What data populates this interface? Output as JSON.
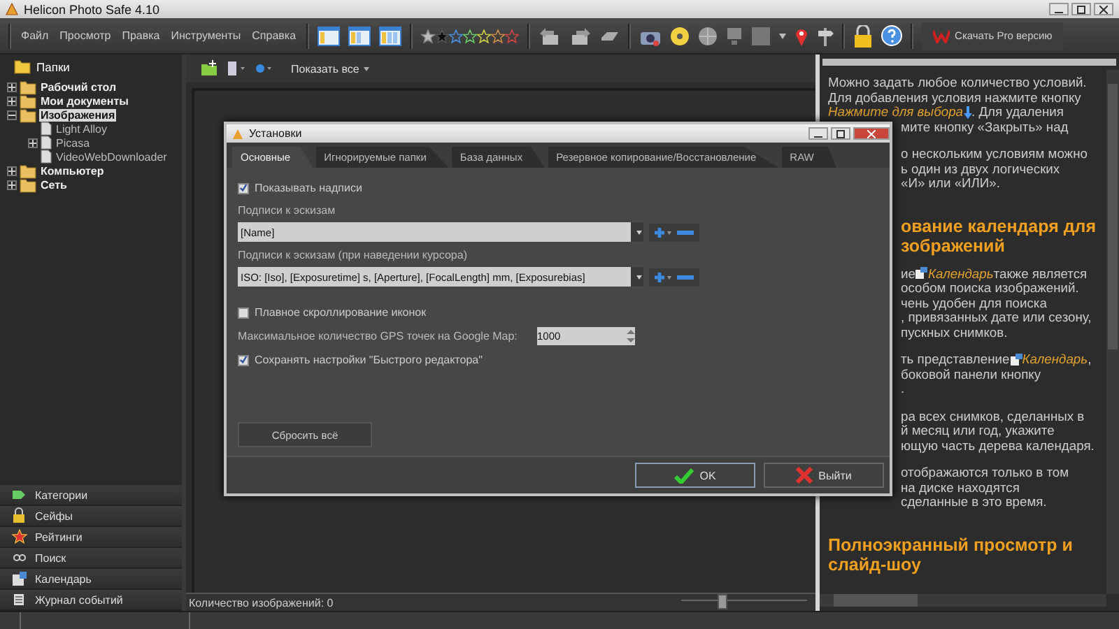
{
  "window": {
    "title": "Helicon Photo Safe 4.10"
  },
  "menu": [
    "Файл",
    "Просмотр",
    "Правка",
    "Инструменты",
    "Справка"
  ],
  "pro_button": "Скачать Pro версию",
  "folders": {
    "title": "Папки",
    "tree": [
      {
        "label": "Рабочий стол",
        "expanded": false,
        "selected": false
      },
      {
        "label": "Мои документы",
        "expanded": false,
        "selected": false
      },
      {
        "label": "Изображения",
        "expanded": true,
        "selected": true,
        "children": [
          {
            "label": "Light Alloy",
            "selected": false
          },
          {
            "label": "Picasa",
            "expanded": false,
            "selected": false
          },
          {
            "label": "VideoWebDownloader",
            "selected": false
          }
        ]
      },
      {
        "label": "Компьютер",
        "expanded": false,
        "selected": false
      },
      {
        "label": "Сеть",
        "expanded": false,
        "selected": false
      }
    ]
  },
  "side_panels": [
    {
      "label": "Категории",
      "kind": "tags"
    },
    {
      "label": "Сейфы",
      "kind": "lock"
    },
    {
      "label": "Рейтинги",
      "kind": "rating"
    },
    {
      "label": "Поиск",
      "kind": "search"
    },
    {
      "label": "Календарь",
      "kind": "calendar"
    },
    {
      "label": "Журнал событий",
      "kind": "log"
    }
  ],
  "view_toolbar": {
    "filter": "Показать все"
  },
  "status_bar": {
    "count": "Количество изображений: 0",
    "zoom_slider": {
      "level": 0.3
    }
  },
  "help": {
    "blocks": [
      {
        "kind": "text",
        "lines": [
          {
            "covered": false,
            "segments": [
              {
                "kind": "text",
                "text": "Можно задать любое количество условий."
              }
            ]
          },
          {
            "covered": false,
            "segments": [
              {
                "kind": "text",
                "text": "Для добавления условия нажмите кнопку"
              }
            ]
          },
          {
            "covered": false,
            "segments": [
              {
                "kind": "link",
                "text": "Нажмите для выбора"
              },
              {
                "kind": "arrow"
              },
              {
                "kind": "text",
                "text": " . Для удаления"
              }
            ]
          },
          {
            "covered": true,
            "segments": [
              {
                "kind": "text",
                "text": "мите кнопку «Закрыть» над"
              }
            ]
          }
        ]
      },
      {
        "kind": "text",
        "lines": [
          {
            "covered": true,
            "segments": [
              {
                "kind": "text",
                "text": "о нескольким условиям можно"
              }
            ]
          },
          {
            "covered": true,
            "segments": [
              {
                "kind": "text",
                "text": "ь один из двух логических"
              }
            ]
          },
          {
            "covered": true,
            "segments": [
              {
                "kind": "text",
                "text": "«И» или «ИЛИ»."
              }
            ]
          }
        ]
      },
      {
        "kind": "heading",
        "lines": [
          {
            "covered": true,
            "segments": [
              {
                "kind": "text",
                "text": "ование календаря для"
              }
            ]
          },
          {
            "covered": true,
            "segments": [
              {
                "kind": "text",
                "text": "зображений"
              }
            ]
          }
        ]
      },
      {
        "kind": "text",
        "lines": [
          {
            "covered": true,
            "segments": [
              {
                "kind": "text",
                "text": "ие "
              },
              {
                "kind": "calendar"
              },
              {
                "kind": "link",
                "text": "Календарь"
              },
              {
                "kind": "text",
                "text": " также является"
              }
            ]
          },
          {
            "covered": true,
            "segments": [
              {
                "kind": "text",
                "text": "особом поиска изображений."
              }
            ]
          },
          {
            "covered": true,
            "segments": [
              {
                "kind": "text",
                "text": "чень удобен для поиска"
              }
            ]
          },
          {
            "covered": true,
            "segments": [
              {
                "kind": "text",
                "text": ", привязанных дате или сезону,"
              }
            ]
          },
          {
            "covered": true,
            "segments": [
              {
                "kind": "text",
                "text": "пускных снимков."
              }
            ]
          }
        ]
      },
      {
        "kind": "text",
        "lines": [
          {
            "covered": true,
            "segments": [
              {
                "kind": "text",
                "text": "ть представление "
              },
              {
                "kind": "calendar"
              },
              {
                "kind": "link",
                "text": "Календарь"
              },
              {
                "kind": "text",
                "text": ","
              }
            ]
          },
          {
            "covered": true,
            "segments": [
              {
                "kind": "text",
                "text": "боковой панели кнопку"
              }
            ]
          },
          {
            "covered": true,
            "segments": [
              {
                "kind": "text",
                "text": "."
              }
            ]
          }
        ]
      },
      {
        "kind": "text",
        "lines": [
          {
            "covered": true,
            "segments": [
              {
                "kind": "text",
                "text": "ра всех снимков, сделанных в"
              }
            ]
          },
          {
            "covered": true,
            "segments": [
              {
                "kind": "text",
                "text": "й месяц или год, укажите"
              }
            ]
          },
          {
            "covered": true,
            "segments": [
              {
                "kind": "text",
                "text": "ющую часть дерева календаря."
              }
            ]
          }
        ]
      },
      {
        "kind": "text",
        "lines": [
          {
            "covered": true,
            "segments": [
              {
                "kind": "text",
                "text": "отображаются только в том"
              }
            ]
          },
          {
            "covered": true,
            "segments": [
              {
                "kind": "text",
                "text": "на диске находятся"
              }
            ]
          },
          {
            "covered": true,
            "segments": [
              {
                "kind": "text",
                "text": "сделанные в это время."
              }
            ]
          }
        ]
      },
      {
        "kind": "heading",
        "lines": [
          {
            "covered": false,
            "segments": [
              {
                "kind": "text",
                "text": "Полноэкранный просмотр и"
              }
            ]
          },
          {
            "covered": false,
            "segments": [
              {
                "kind": "text",
                "text": "слайд-шоу"
              }
            ]
          }
        ]
      }
    ]
  },
  "dialog": {
    "title": "Установки",
    "tabs": [
      {
        "label": "Основные",
        "selected": true
      },
      {
        "label": "Игнорируемые папки",
        "selected": false
      },
      {
        "label": "База данных",
        "selected": false
      },
      {
        "label": "Резервное копирование/Восстановление",
        "selected": false
      },
      {
        "label": "RAW",
        "selected": false
      }
    ],
    "show_captions": {
      "label": "Показывать надписи",
      "checked": true
    },
    "thumb_captions": {
      "label": "Подписи к эскизам",
      "value": "[Name]"
    },
    "hover_captions": {
      "label": "Подписи к эскизам (при наведении курсора)",
      "value": "ISO: [Iso], [Exposuretime] s, [Aperture], [FocalLength] mm, [Exposurebias]"
    },
    "smooth_scroll": {
      "label": "Плавное скроллирование иконок",
      "checked": false
    },
    "gps_points": {
      "label": "Максимальное количество GPS точек на Google Map:",
      "value": "1000"
    },
    "save_editor": {
      "label": "Сохранять настройки \"Быстрого редактора\"",
      "checked": true
    },
    "reset_button": "Сбросить всё",
    "ok_button": "OK",
    "exit_button": "Выйти"
  }
}
